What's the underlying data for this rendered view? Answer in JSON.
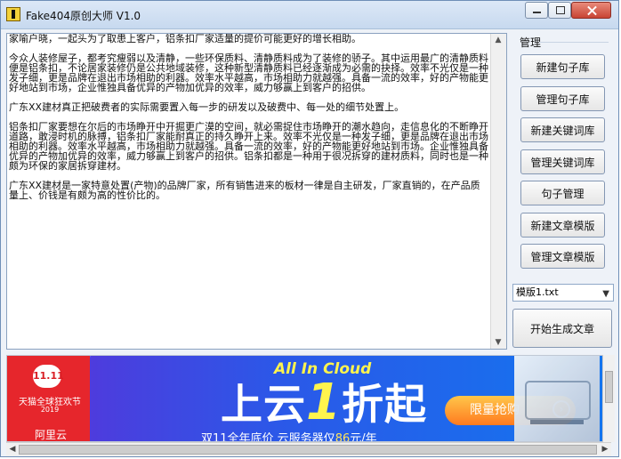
{
  "window": {
    "title": "Fake404原创大师 V1.0"
  },
  "editor": {
    "paragraphs": [
      "家喻户晓，一起头为了取患上客户，铝条扣厂家适量的提价可能更好的增长相助。",
      "今众人装修屋子，都考究瘦弱以及清静，一些环保质料、清静质料成为了装修的骄子。其中运用最广的清静质料便是铝条扣，不论居家装修仍是公共地域装修，这种新型清静质料已经逐渐成为必需的抉择。效率不光仅是一种发子细，更是品牌在退出市场相助的利器。效率水平越高，市场相助力就越强。具备一流的效率，好的产物能更好地站到市场，企业惟独具备优异的产物加优异的效率，威力够赢上到客户的招供。",
      "广东XX建材真正把破费者的实际需要置入每一步的研发以及破费中、每一处的细节处置上。",
      "铝条扣厂家要想在尔后的市场睁开中开掘更广漠的空间，就必需捉住市场睁开的潮水趋向，走信息化的不断睁开道路，敢浸时机的脉搏，铝条扣厂家能耐真正的持久睁开上来。效率不光仅是一种发子细，更是品牌在退出市场相助的利器。效率水平越高，市场相助力就越强。具备一流的效率，好的产物能更好地站到市场。企业惟独具备优异的产物加优异的效率，威力够赢上到客户的招供。铝条扣都是一种用于很况拆穿的建材质料，同时也是一种颇为环保的家居拆穿建材。",
      "广东XX建材是一家特意处置(产物)的品牌厂家，所有销售进来的板材一律是自主研发，厂家直销的，在产品质量上、价钱是有颇为高的性价比的。"
    ]
  },
  "sidebar": {
    "group_title": "管理",
    "buttons": [
      "新建句子库",
      "管理句子库",
      "新建关键词库",
      "管理关键词库",
      "句子管理",
      "新建文章模版",
      "管理文章模版"
    ],
    "template_select": "模版1.txt",
    "generate_button": "开始生成文章"
  },
  "ad": {
    "left_badge": "11.11",
    "left_text": "天猫全球狂欢节",
    "left_year": "2019",
    "left_brand": "阿里云",
    "top_title": "All In Cloud",
    "headline_prefix": "上云",
    "headline_number": "1",
    "headline_suffix": "折起",
    "sub_prefix": "双11全年底价  云服务器仅",
    "sub_price": "86",
    "sub_suffix": "元/年",
    "cta": "限量抢购",
    "cta_arrow": "›"
  }
}
